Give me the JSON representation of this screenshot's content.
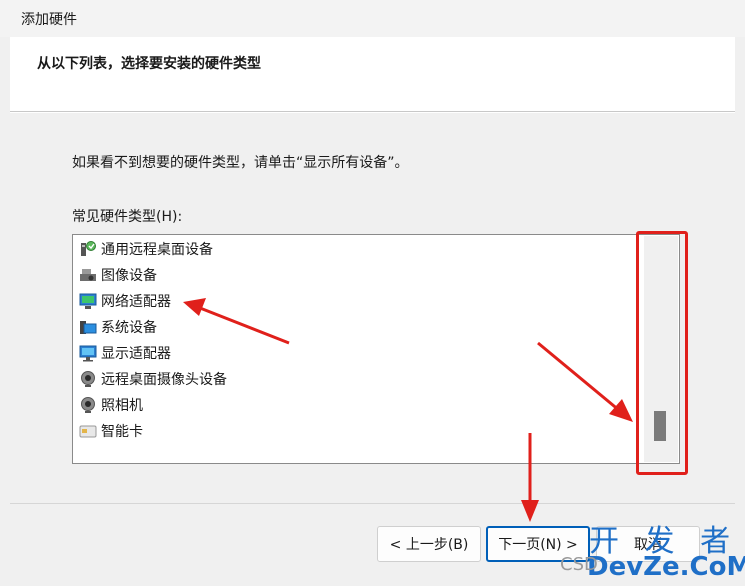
{
  "window": {
    "title": "添加硬件"
  },
  "header": {
    "heading": "从以下列表，选择要安装的硬件类型"
  },
  "main": {
    "instruction": "如果看不到想要的硬件类型，请单击“显示所有设备”。",
    "list_label": "常见硬件类型(H):",
    "items": [
      {
        "label": "通用远程桌面设备",
        "icon": "remote-desktop-device-icon"
      },
      {
        "label": "图像设备",
        "icon": "imaging-device-icon"
      },
      {
        "label": "网络适配器",
        "icon": "network-adapter-icon"
      },
      {
        "label": "系统设备",
        "icon": "system-device-icon"
      },
      {
        "label": "显示适配器",
        "icon": "display-adapter-icon"
      },
      {
        "label": "远程桌面摄像头设备",
        "icon": "remote-camera-icon"
      },
      {
        "label": "照相机",
        "icon": "camera-icon"
      },
      {
        "label": "智能卡",
        "icon": "smart-card-icon"
      }
    ]
  },
  "buttons": {
    "back": "< 上一步(B)",
    "next": "下一页(N) >",
    "cancel": "取消"
  },
  "watermark": {
    "top": "开 发 者",
    "bottom": "DevZe.CoM",
    "csdn": "CSD"
  },
  "colors": {
    "annotation": "#e0201b",
    "focus": "#005fb8"
  }
}
